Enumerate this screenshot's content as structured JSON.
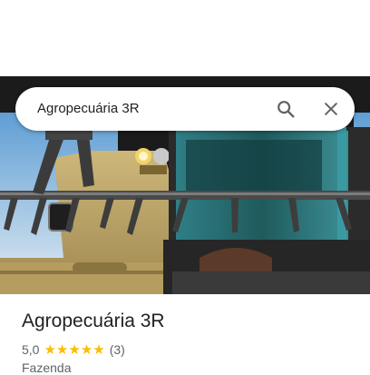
{
  "search": {
    "query": "Agropecuária 3R",
    "search_icon": "search-icon",
    "close_icon": "close-icon"
  },
  "place": {
    "name": "Agropecuária 3R",
    "rating": "5,0",
    "stars_filled": 5,
    "stars_total": 5,
    "review_count": "(3)",
    "category": "Fazenda",
    "star_color": "#fbbc04"
  },
  "photo": {
    "subject": "combine-harvester-photo"
  }
}
